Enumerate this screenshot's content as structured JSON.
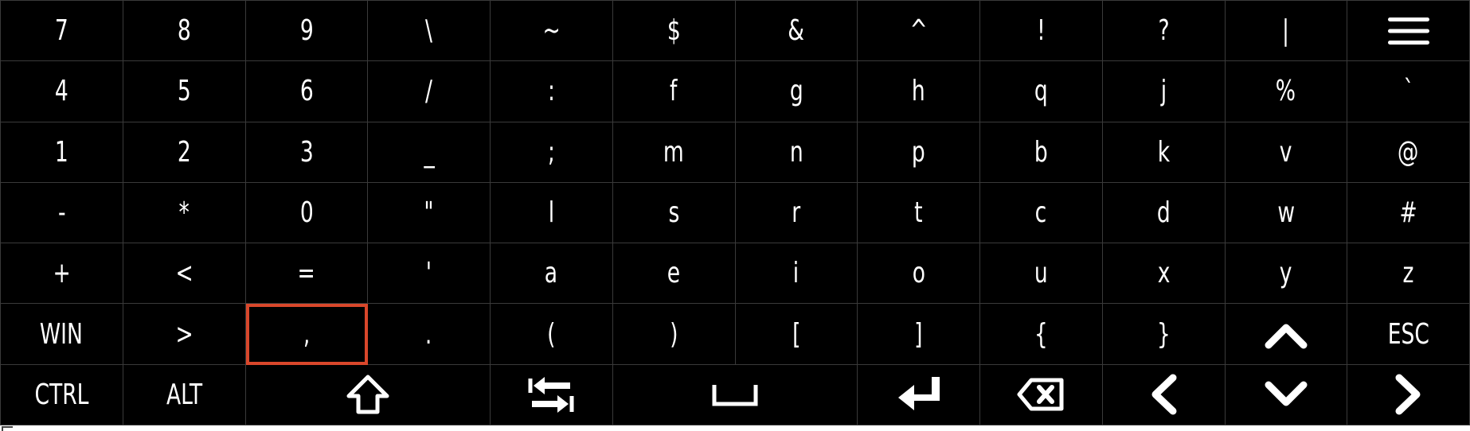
{
  "keyboard": {
    "rows": [
      [
        {
          "name": "key-7",
          "label": "7"
        },
        {
          "name": "key-8",
          "label": "8"
        },
        {
          "name": "key-9",
          "label": "9"
        },
        {
          "name": "key-backslash",
          "label": "\\"
        },
        {
          "name": "key-tilde",
          "label": "~"
        },
        {
          "name": "key-dollar",
          "label": "$"
        },
        {
          "name": "key-ampersand",
          "label": "&"
        },
        {
          "name": "key-caret",
          "label": "^"
        },
        {
          "name": "key-exclamation",
          "label": "!"
        },
        {
          "name": "key-question",
          "label": "?"
        },
        {
          "name": "key-pipe",
          "label": "|"
        },
        {
          "name": "menu-key",
          "icon": "hamburger-menu-icon"
        }
      ],
      [
        {
          "name": "key-4",
          "label": "4"
        },
        {
          "name": "key-5",
          "label": "5"
        },
        {
          "name": "key-6",
          "label": "6"
        },
        {
          "name": "key-slash",
          "label": "/"
        },
        {
          "name": "key-colon",
          "label": ":"
        },
        {
          "name": "key-f",
          "label": "f"
        },
        {
          "name": "key-g",
          "label": "g"
        },
        {
          "name": "key-h",
          "label": "h"
        },
        {
          "name": "key-q",
          "label": "q"
        },
        {
          "name": "key-j",
          "label": "j"
        },
        {
          "name": "key-percent",
          "label": "%"
        },
        {
          "name": "key-backtick",
          "label": "`"
        }
      ],
      [
        {
          "name": "key-1",
          "label": "1"
        },
        {
          "name": "key-2",
          "label": "2"
        },
        {
          "name": "key-3",
          "label": "3"
        },
        {
          "name": "key-underscore",
          "label": "_"
        },
        {
          "name": "key-semicolon",
          "label": ";"
        },
        {
          "name": "key-m",
          "label": "m"
        },
        {
          "name": "key-n",
          "label": "n"
        },
        {
          "name": "key-p",
          "label": "p"
        },
        {
          "name": "key-b",
          "label": "b"
        },
        {
          "name": "key-k",
          "label": "k"
        },
        {
          "name": "key-v",
          "label": "v"
        },
        {
          "name": "key-at",
          "label": "@"
        }
      ],
      [
        {
          "name": "key-minus",
          "label": "-"
        },
        {
          "name": "key-asterisk",
          "label": "*"
        },
        {
          "name": "key-0",
          "label": "0"
        },
        {
          "name": "key-double-quote",
          "label": "\""
        },
        {
          "name": "key-l",
          "label": "l"
        },
        {
          "name": "key-s",
          "label": "s"
        },
        {
          "name": "key-r",
          "label": "r"
        },
        {
          "name": "key-t",
          "label": "t"
        },
        {
          "name": "key-c",
          "label": "c"
        },
        {
          "name": "key-d",
          "label": "d"
        },
        {
          "name": "key-w",
          "label": "w"
        },
        {
          "name": "key-hash",
          "label": "#"
        }
      ],
      [
        {
          "name": "key-plus",
          "label": "+"
        },
        {
          "name": "key-less-than",
          "label": "<"
        },
        {
          "name": "key-equals",
          "label": "="
        },
        {
          "name": "key-single-quote",
          "label": "'"
        },
        {
          "name": "key-a",
          "label": "a"
        },
        {
          "name": "key-e",
          "label": "e"
        },
        {
          "name": "key-i",
          "label": "i"
        },
        {
          "name": "key-o",
          "label": "o"
        },
        {
          "name": "key-u",
          "label": "u"
        },
        {
          "name": "key-x",
          "label": "x"
        },
        {
          "name": "key-y",
          "label": "y"
        },
        {
          "name": "key-z",
          "label": "z"
        }
      ],
      [
        {
          "name": "key-win",
          "label": "WIN"
        },
        {
          "name": "key-greater-than",
          "label": ">"
        },
        {
          "name": "key-comma",
          "label": ",",
          "selected": true
        },
        {
          "name": "key-period",
          "label": "."
        },
        {
          "name": "key-open-paren",
          "label": "("
        },
        {
          "name": "key-close-paren",
          "label": ")"
        },
        {
          "name": "key-open-bracket",
          "label": "["
        },
        {
          "name": "key-close-bracket",
          "label": "]"
        },
        {
          "name": "key-open-brace",
          "label": "{"
        },
        {
          "name": "key-close-brace",
          "label": "}"
        },
        {
          "name": "key-up",
          "icon": "chevron-up-icon"
        },
        {
          "name": "key-esc",
          "label": "ESC"
        }
      ],
      [
        {
          "name": "key-ctrl",
          "label": "CTRL"
        },
        {
          "name": "key-alt",
          "label": "ALT"
        },
        {
          "name": "key-shift",
          "icon": "shift-arrow-icon",
          "span": 2
        },
        {
          "name": "key-tab",
          "icon": "tab-arrows-icon"
        },
        {
          "name": "key-space",
          "icon": "space-bar-icon",
          "span": 2
        },
        {
          "name": "key-enter",
          "icon": "enter-arrow-icon"
        },
        {
          "name": "key-backspace",
          "icon": "backspace-icon"
        },
        {
          "name": "key-left",
          "icon": "chevron-left-icon"
        },
        {
          "name": "key-down",
          "icon": "chevron-down-icon"
        },
        {
          "name": "key-right",
          "icon": "chevron-right-icon"
        }
      ]
    ],
    "colors": {
      "background": "#000000",
      "key_border": "#3a3a3a",
      "text": "#ffffff",
      "selected_outline": "#d9472b"
    }
  }
}
